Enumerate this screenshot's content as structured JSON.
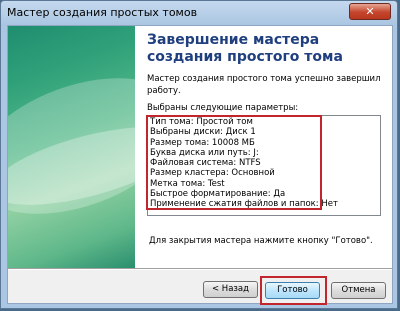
{
  "window": {
    "title": "Мастер создания простых томов",
    "close_glyph": "✕"
  },
  "wizard": {
    "heading": "Завершение мастера создания простого тома",
    "success_text": "Мастер создания простого тома успешно завершил работу.",
    "params_label": "Выбраны следующие параметры:",
    "params": [
      "Тип тома: Простой том",
      "Выбраны диски: Диск 1",
      "Размер тома: 10008 МБ",
      "Буква диска или путь: J:",
      "Файловая система: NTFS",
      "Размер кластера: Основной",
      "Метка тома: Test",
      "Быстрое форматирование: Да",
      "Применение сжатия файлов и папок: Нет"
    ],
    "close_hint": "Для закрытия мастера нажмите кнопку \"Готово\"."
  },
  "buttons": {
    "back": "< Назад",
    "done": "Готово",
    "cancel": "Отмена"
  },
  "colors": {
    "heading": "#1f3f7f",
    "highlight": "#c0262c",
    "side_panel": "#2ea079"
  }
}
